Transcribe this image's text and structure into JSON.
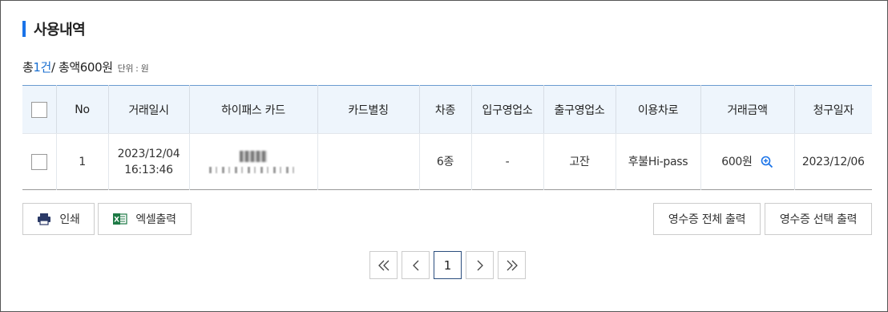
{
  "section": {
    "title": "사용내역"
  },
  "summary": {
    "count_prefix": "총 ",
    "count": "1건",
    "sep": " / 총액 ",
    "total": "600원",
    "unit_note": "단위 : 원"
  },
  "table": {
    "headers": [
      "No",
      "거래일시",
      "하이패스 카드",
      "카드별칭",
      "차종",
      "입구영업소",
      "출구영업소",
      "이용차로",
      "거래금액",
      "청구일자"
    ],
    "rows": [
      {
        "no": "1",
        "date": "2023/12/04",
        "time": "16:13:46",
        "card": "",
        "alias": "",
        "vehicle": "6종",
        "entry": "-",
        "exit": "고잔",
        "lane": "후불Hi-pass",
        "amount": "600원",
        "billing": "2023/12/06"
      }
    ]
  },
  "buttons": {
    "print": "인쇄",
    "excel": "엑셀출력",
    "receipt_all": "영수증 전체 출력",
    "receipt_selected": "영수증 선택 출력"
  },
  "pagination": {
    "first": "«",
    "prev": "‹",
    "current": "1",
    "next": "›",
    "last": "»"
  },
  "colors": {
    "accent": "#1a73e8",
    "header_bg": "#eef5fc",
    "excel_green": "#1d7a45",
    "print_navy": "#2b3a67"
  }
}
